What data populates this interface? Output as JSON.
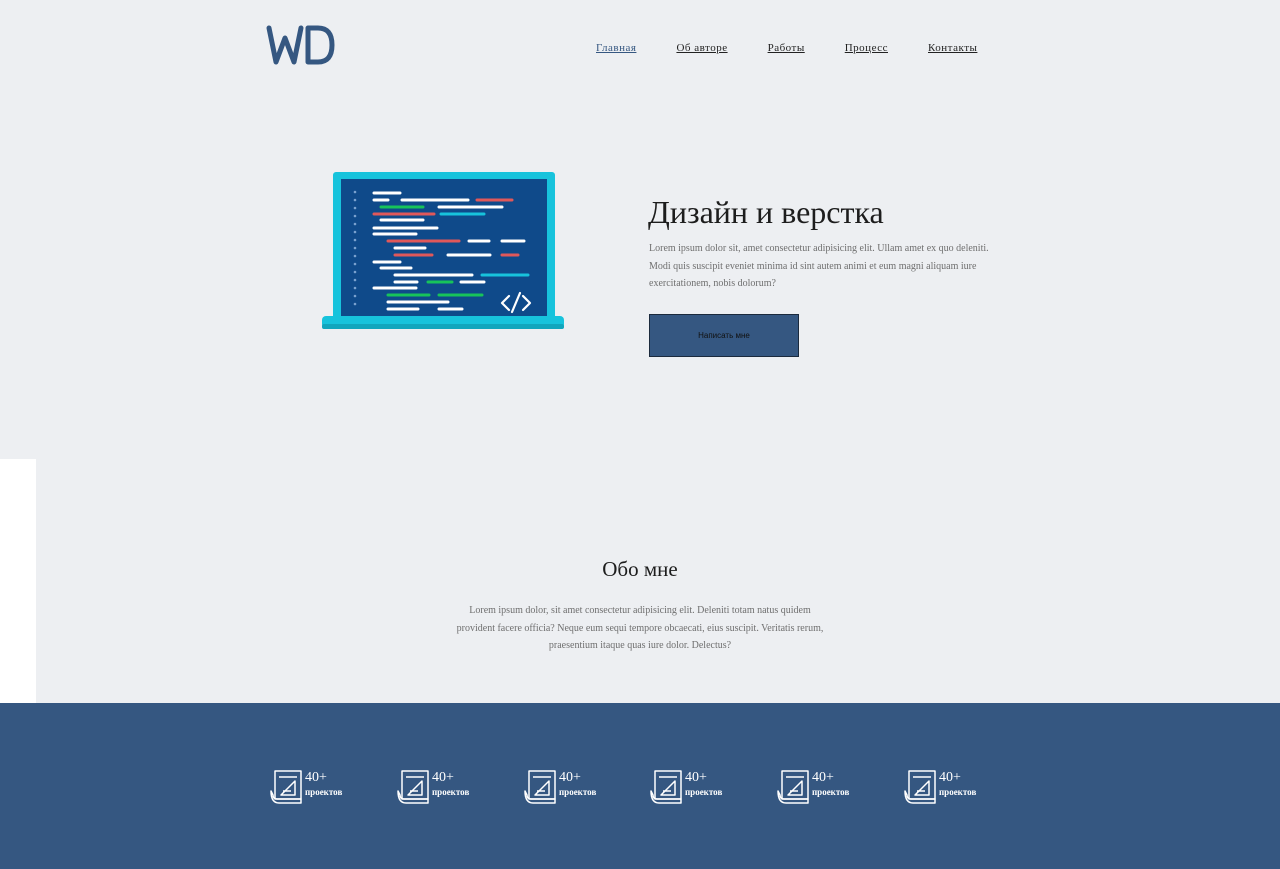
{
  "header": {
    "logo_icon": "wd-logo",
    "nav": [
      {
        "label": "Главная",
        "active": true
      },
      {
        "label": "Об авторе",
        "active": false
      },
      {
        "label": "Работы",
        "active": false
      },
      {
        "label": "Процесс",
        "active": false
      },
      {
        "label": "Контакты",
        "active": false
      }
    ]
  },
  "hero": {
    "illustration_icon": "laptop-code-icon",
    "title": "Дизайн и верстка",
    "text": "Lorem ipsum dolor sit, amet consectetur adipisicing elit. Ullam amet ex quo deleniti. Modi quis suscipit eveniet minima id sint autem animi et eum magni aliquam iure exercitationem, nobis dolorum?",
    "button_label": "Написать мне"
  },
  "about": {
    "title": "Обо мне",
    "text": "Lorem ipsum dolor, sit amet consectetur adipisicing elit. Deleniti totam natus quidem provident facere officia? Neque eum sequi tempore obcaecati, eius suscipit. Veritatis rerum, praesentium itaque quas iure dolor. Delectus?"
  },
  "stats": [
    {
      "icon": "blueprint-icon",
      "number": "40+",
      "label": "проектов"
    },
    {
      "icon": "blueprint-icon",
      "number": "40+",
      "label": "проектов"
    },
    {
      "icon": "blueprint-icon",
      "number": "40+",
      "label": "проектов"
    },
    {
      "icon": "blueprint-icon",
      "number": "40+",
      "label": "проектов"
    },
    {
      "icon": "blueprint-icon",
      "number": "40+",
      "label": "проектов"
    },
    {
      "icon": "blueprint-icon",
      "number": "40+",
      "label": "проектов"
    }
  ],
  "colors": {
    "background": "#edeff2",
    "primary": "#355781",
    "accent_cyan": "#17c3dc",
    "text_muted": "#6f6f6f"
  }
}
